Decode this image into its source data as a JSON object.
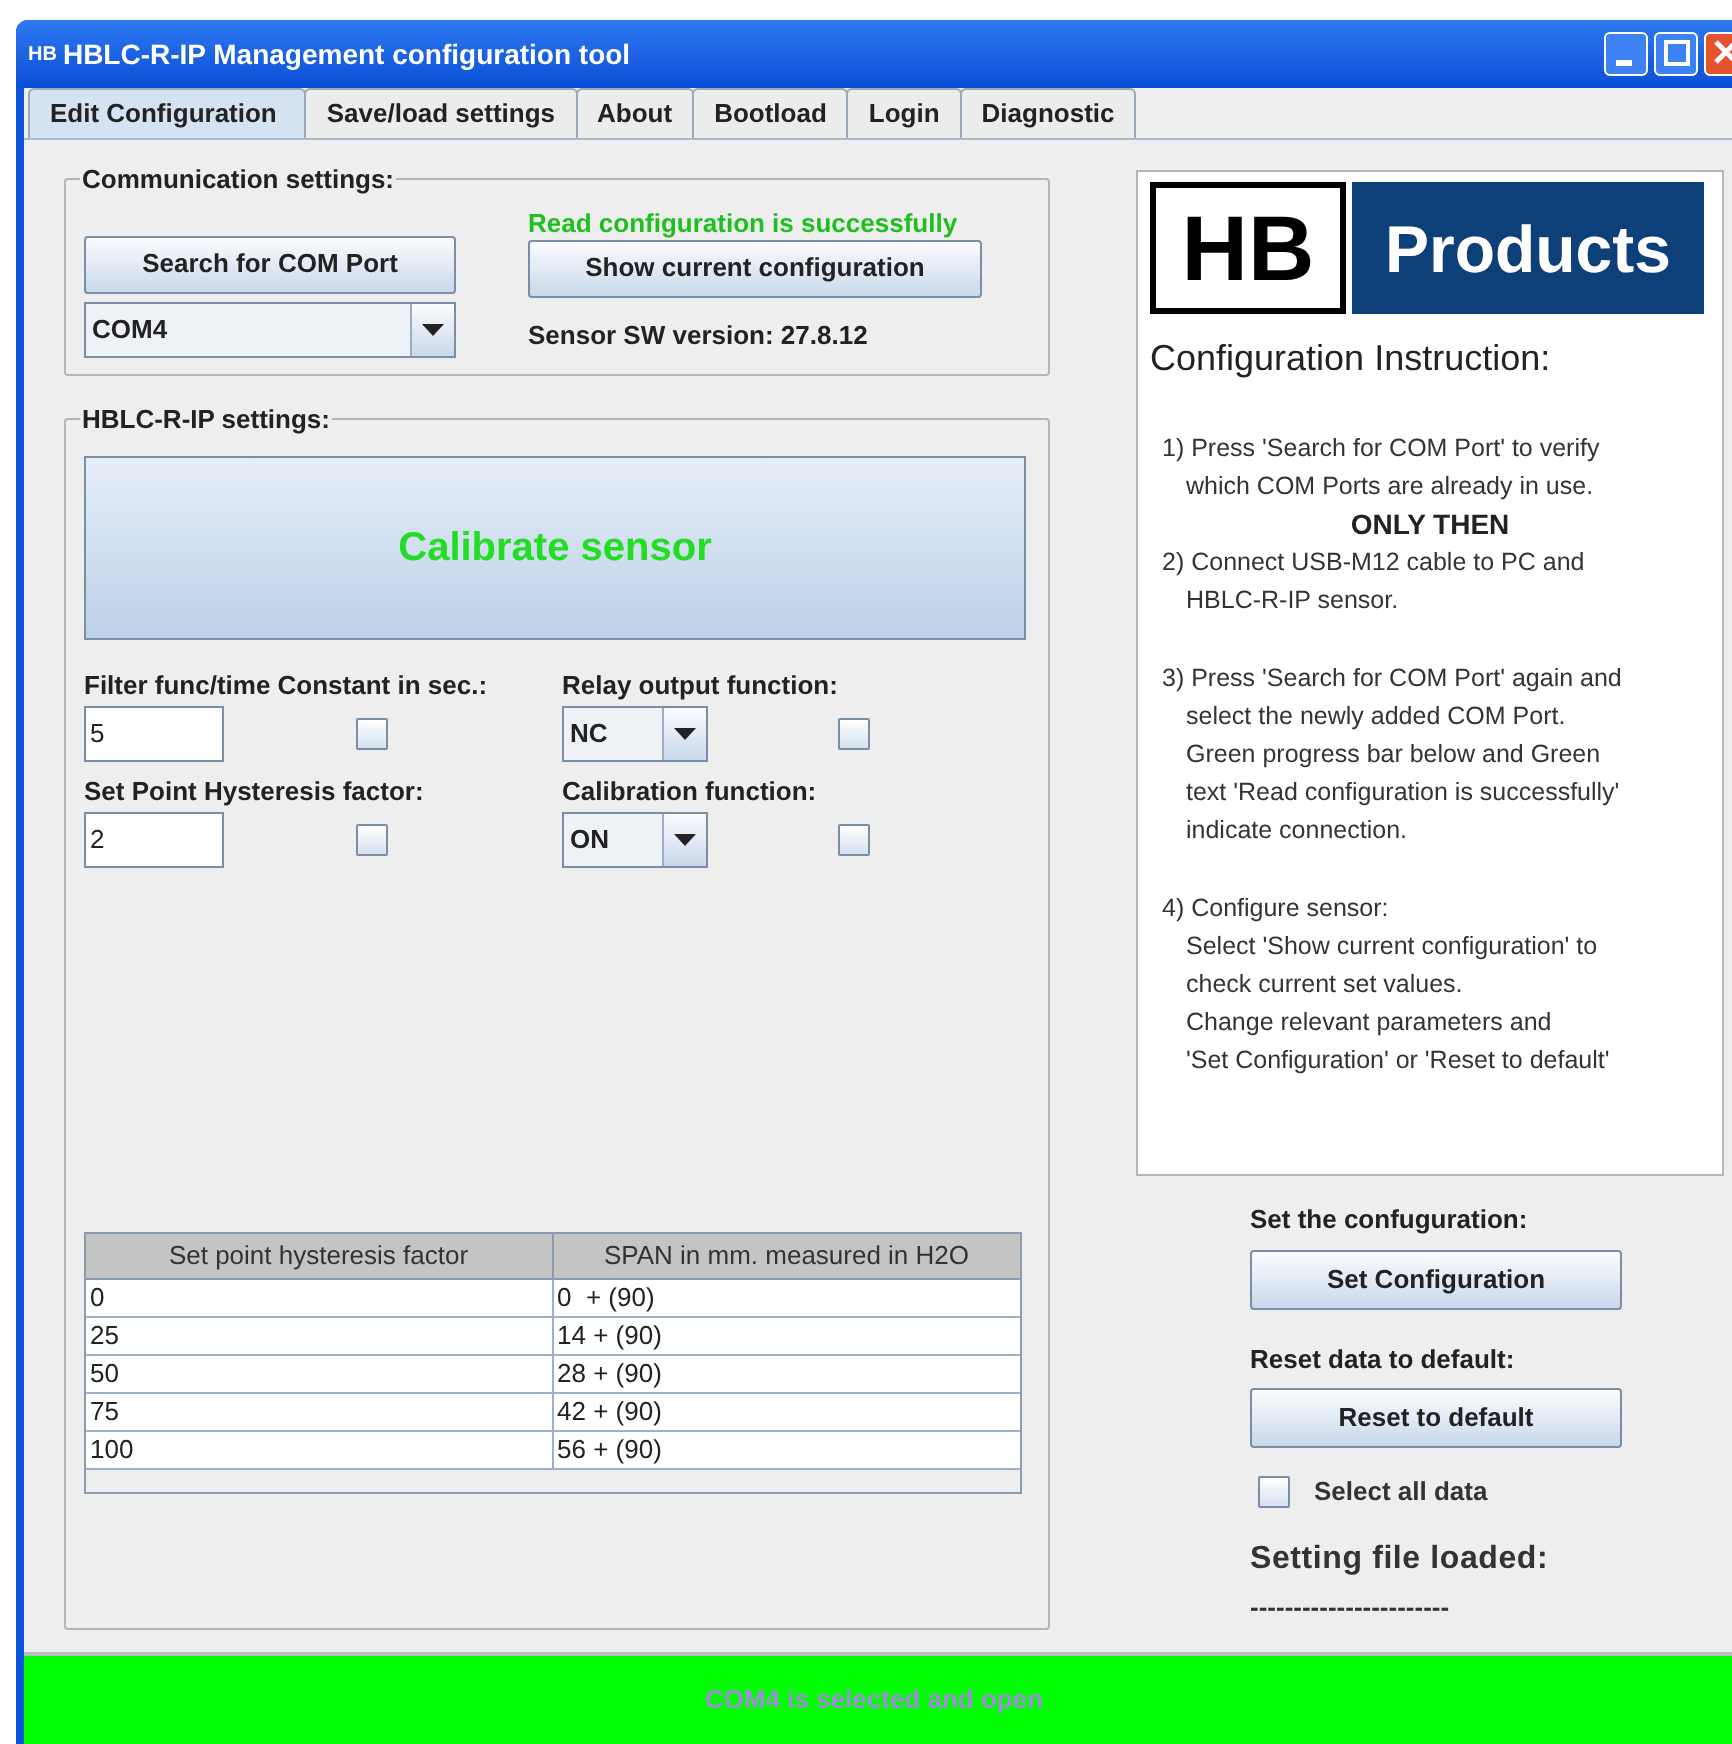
{
  "window": {
    "icon": "HB",
    "title": "HBLC-R-IP Management configuration tool"
  },
  "tabs": [
    {
      "label": "Edit Configuration",
      "selected": true
    },
    {
      "label": "Save/load settings",
      "selected": false
    },
    {
      "label": "About",
      "selected": false
    },
    {
      "label": "Bootload",
      "selected": false
    },
    {
      "label": "Login",
      "selected": false
    },
    {
      "label": "Diagnostic",
      "selected": false
    }
  ],
  "communication": {
    "legend": "Communication settings:",
    "search_button": "Search for COM Port",
    "port": {
      "value": "COM4"
    },
    "read_status": "Read configuration is successfully",
    "show_button": "Show current configuration",
    "sw_version": "Sensor SW version: 27.8.12"
  },
  "settings": {
    "legend": "HBLC-R-IP settings:",
    "calibrate_button": "Calibrate sensor",
    "fields": [
      {
        "kind": "text",
        "label": "Filter func/time Constant in sec.:",
        "value": "5",
        "checked": false
      },
      {
        "kind": "select",
        "label": "Relay output function:",
        "value": "NC",
        "checked": false
      },
      {
        "kind": "text",
        "label": "Set Point Hysteresis factor:",
        "value": "2",
        "checked": false
      },
      {
        "kind": "select",
        "label": "Calibration function:",
        "value": "ON",
        "checked": false
      }
    ],
    "table": {
      "columns": [
        "Set point hysteresis factor",
        "SPAN in mm. measured in H2O"
      ],
      "rows": [
        [
          "0",
          "0  + (90)"
        ],
        [
          "25",
          "14 + (90)"
        ],
        [
          "50",
          "28 + (90)"
        ],
        [
          "75",
          "42 + (90)"
        ],
        [
          "100",
          "56 + (90)"
        ]
      ]
    }
  },
  "logo": {
    "left": "HB",
    "right": "Products"
  },
  "instructions": {
    "title": "Configuration Instruction:",
    "sections": [
      [
        {
          "kind": "step",
          "lines": [
            "1) Press 'Search for COM Port' to verify",
            "which COM Ports are already in use."
          ]
        },
        {
          "kind": "emphasis",
          "lines": [
            "ONLY THEN"
          ]
        },
        {
          "kind": "step",
          "lines": [
            "2) Connect USB-M12 cable to PC and",
            "HBLC-R-IP sensor."
          ]
        }
      ],
      [
        {
          "kind": "step",
          "lines": [
            "3) Press 'Search for COM Port' again and",
            "select the newly added COM Port.",
            "Green progress bar below and Green",
            "text 'Read configuration is successfully'",
            "indicate connection."
          ]
        }
      ],
      [
        {
          "kind": "step",
          "lines": [
            "4) Configure sensor:",
            "Select 'Show current configuration' to",
            "check current set values.",
            "Change relevant parameters and",
            "'Set Configuration' or 'Reset to default'"
          ]
        }
      ]
    ]
  },
  "actions": {
    "set_label": "Set the confuguration:",
    "set_button": "Set Configuration",
    "reset_label": "Reset data to default:",
    "reset_button": "Reset to default",
    "select_all": {
      "label": "Select all data",
      "checked": false
    },
    "file_label": "Setting file loaded:",
    "file_name": "-----------------------"
  },
  "status_bar": {
    "text": "COM4 is selected and open",
    "level": 1
  }
}
